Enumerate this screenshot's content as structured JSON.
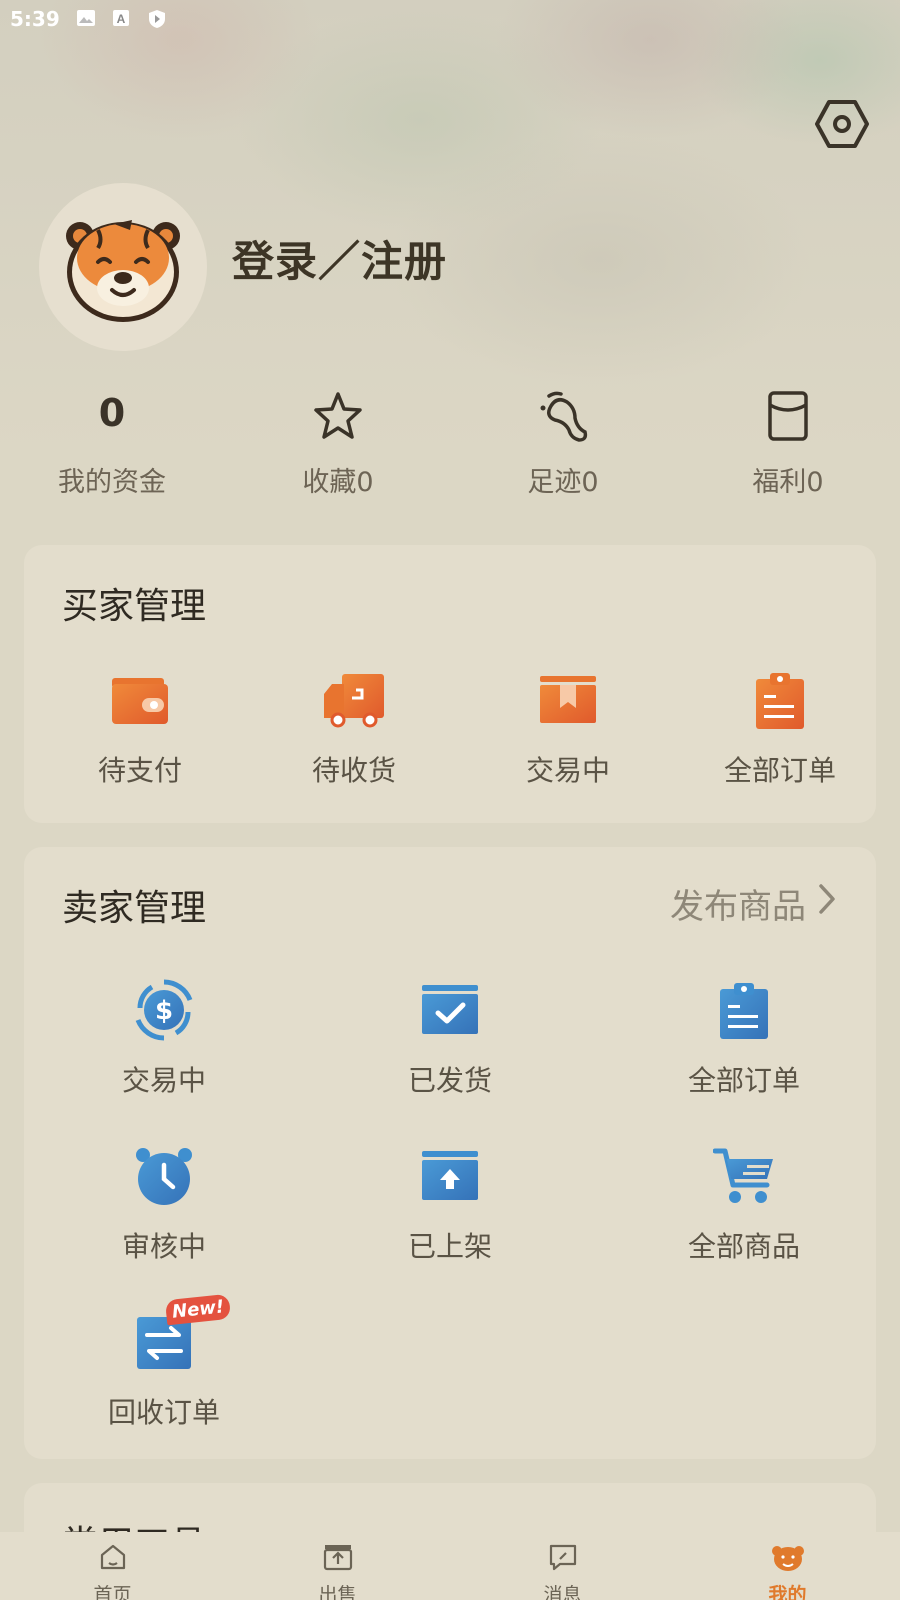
{
  "status_bar": {
    "time": "5:39"
  },
  "profile": {
    "title": "登录／注册"
  },
  "stats": [
    {
      "value": "0",
      "label": "我的资金",
      "icon": "wallet-value"
    },
    {
      "label": "收藏0",
      "icon": "star-icon"
    },
    {
      "label": "足迹0",
      "icon": "footprint-icon"
    },
    {
      "label": "福利0",
      "icon": "coupon-icon"
    }
  ],
  "buyer": {
    "title": "买家管理",
    "items": [
      {
        "label": "待支付",
        "icon": "wallet-icon"
      },
      {
        "label": "待收货",
        "icon": "truck-icon"
      },
      {
        "label": "交易中",
        "icon": "box-icon"
      },
      {
        "label": "全部订单",
        "icon": "clipboard-icon"
      }
    ]
  },
  "seller": {
    "title": "卖家管理",
    "link": "发布商品",
    "items": [
      {
        "label": "交易中",
        "icon": "dollar-refresh-icon"
      },
      {
        "label": "已发货",
        "icon": "check-box-icon"
      },
      {
        "label": "全部订单",
        "icon": "clipboard-icon"
      },
      {
        "label": "审核中",
        "icon": "alarm-clock-icon"
      },
      {
        "label": "已上架",
        "icon": "upload-box-icon"
      },
      {
        "label": "全部商品",
        "icon": "cart-icon"
      },
      {
        "label": "回收订单",
        "icon": "exchange-icon",
        "badge": "New!"
      }
    ]
  },
  "tools": {
    "title": "常用工具"
  },
  "tabbar": [
    {
      "label": "首页",
      "icon": "home-icon"
    },
    {
      "label": "出售",
      "icon": "sell-icon"
    },
    {
      "label": "消息",
      "icon": "message-icon"
    },
    {
      "label": "我的",
      "icon": "tiger-icon",
      "active": true
    }
  ],
  "colors": {
    "accent": "#e07a2c",
    "seller_blue": "#3f8fcf",
    "buyer_orange": "#e8742f"
  }
}
